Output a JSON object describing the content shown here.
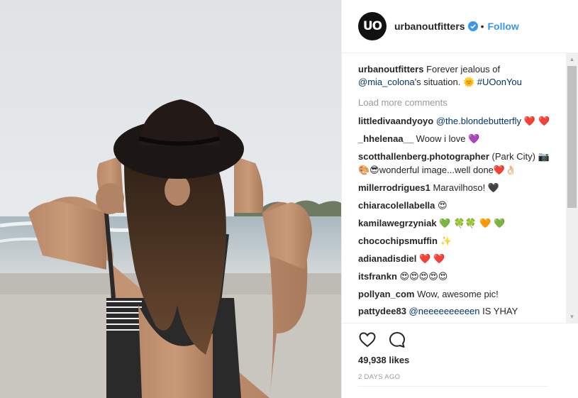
{
  "header": {
    "avatar_text": "UO",
    "username": "urbanoutfitters",
    "separator": "•",
    "follow_label": "Follow"
  },
  "caption": {
    "username": "urbanoutfitters",
    "text_1": "Forever jealous of",
    "mention": "@mia_colona",
    "text_2": "'s situation.",
    "emoji": "🌞",
    "hashtag": "#UOonYou"
  },
  "load_more_label": "Load more comments",
  "comments": [
    {
      "user": "littledivaandyoyo",
      "mention": "@the.blondebutterfly",
      "text": "",
      "emoji": "❤️ ❤️"
    },
    {
      "user": "_hhelenaa__",
      "mention": "",
      "text": "Woow i love",
      "emoji": "💜"
    },
    {
      "user": "scotthallenberg.photographer",
      "mention": "",
      "text": "(Park City)",
      "emoji2": "📷🎨😎",
      "text2": "wonderful image...well done",
      "emoji3": "❤️👌🏻"
    },
    {
      "user": "millerrodrigues1",
      "mention": "",
      "text": "Maravilhoso!",
      "emoji": "🖤"
    },
    {
      "user": "chiaracolellabella",
      "mention": "",
      "text": "",
      "emoji": "😍"
    },
    {
      "user": "kamilawegrzyniak",
      "mention": "",
      "text": "",
      "emoji": "💚 🍀🍀 🧡 💚"
    },
    {
      "user": "chocochipsmuffin",
      "mention": "",
      "text": "",
      "emoji": "✨"
    },
    {
      "user": "adianadisdiel",
      "mention": "",
      "text": "",
      "emoji": "❤️ ❤️"
    },
    {
      "user": "itsfrankn",
      "mention": "",
      "text": "",
      "emoji": "😍😍😍😍😍"
    },
    {
      "user": "pollyan_com",
      "mention": "",
      "text": "Wow, awesome pic!",
      "emoji": ""
    },
    {
      "user": "pattydee83",
      "mention": "@neeeeeeeeeen",
      "text": "IS YHAY",
      "emoji": ""
    }
  ],
  "likes": "49,938 likes",
  "time_ago": "2 DAYS AGO",
  "icons": {
    "like": "heart-icon",
    "comment": "comment-bubble-icon",
    "verified": "verified-badge-icon"
  },
  "colors": {
    "link": "#3897f0",
    "mention": "#003569",
    "muted": "#999999"
  }
}
